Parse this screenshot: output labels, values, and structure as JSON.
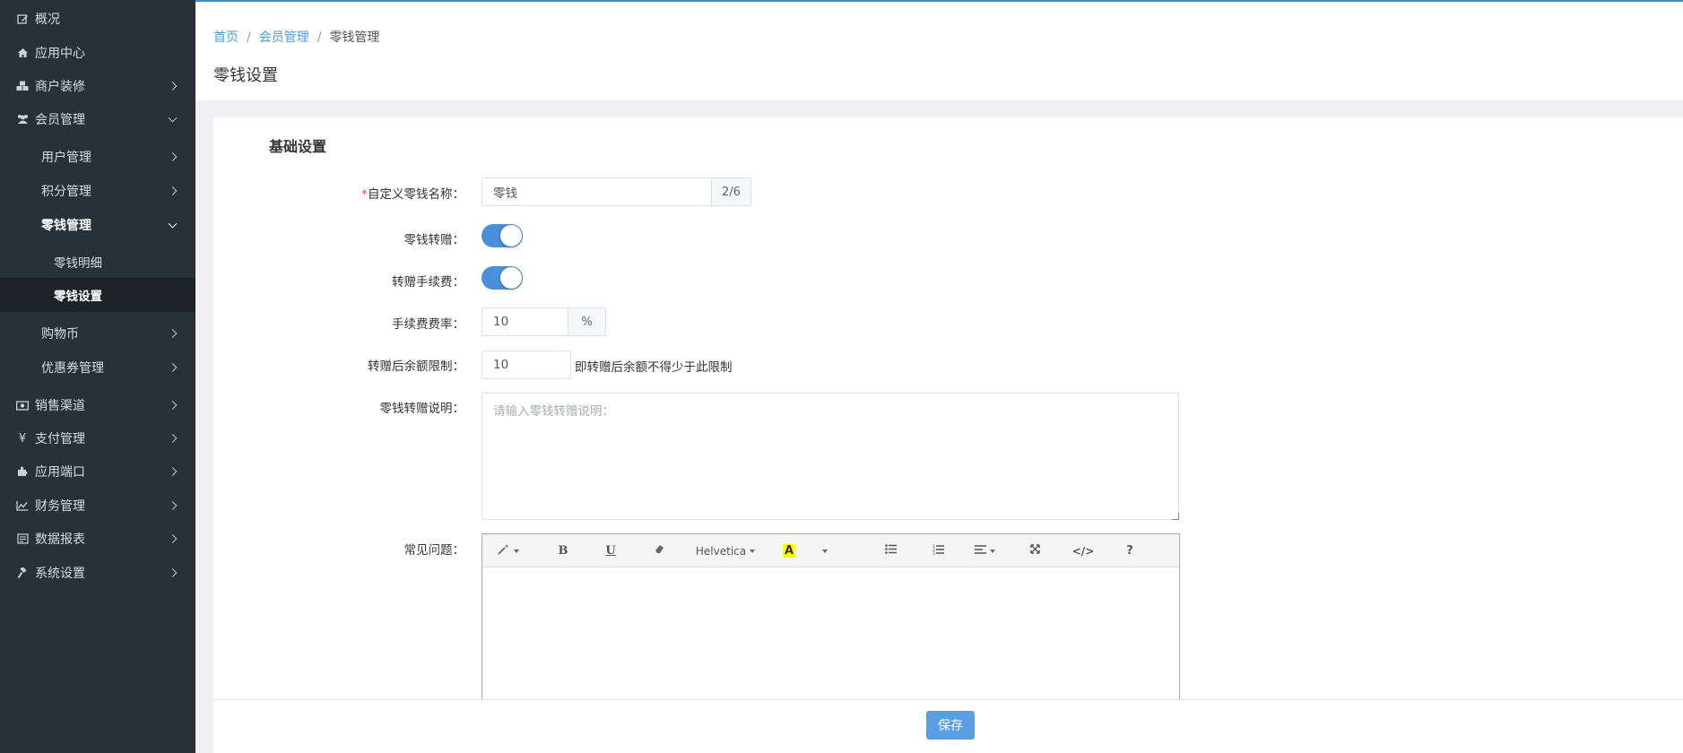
{
  "sidebar": {
    "items": [
      {
        "label": "概况",
        "icon": "edit-icon"
      },
      {
        "label": "应用中心",
        "icon": "home-icon"
      },
      {
        "label": "商户装修",
        "icon": "cubes-icon"
      },
      {
        "label": "会员管理",
        "icon": "users-icon"
      },
      {
        "label": "用户管理"
      },
      {
        "label": "积分管理"
      },
      {
        "label": "零钱管理"
      },
      {
        "label": "零钱明细"
      },
      {
        "label": "零钱设置"
      },
      {
        "label": "购物币"
      },
      {
        "label": "优惠券管理"
      },
      {
        "label": "销售渠道",
        "icon": "money-icon"
      },
      {
        "label": "支付管理",
        "icon": "yen-icon"
      },
      {
        "label": "应用端口",
        "icon": "puzzle-icon"
      },
      {
        "label": "财务管理",
        "icon": "line-chart-icon"
      },
      {
        "label": "数据报表",
        "icon": "report-icon"
      },
      {
        "label": "系统设置",
        "icon": "gavel-icon"
      }
    ]
  },
  "breadcrumb": {
    "home": "首页",
    "sep": "/",
    "members": "会员管理",
    "current": "零钱管理"
  },
  "page_title": "零钱设置",
  "section_title": "基础设置",
  "form": {
    "name_label": "自定义零钱名称：",
    "name_required": "*",
    "name_value": "零钱",
    "name_count": "2/6",
    "transfer_label": "零钱转赠：",
    "transfer_on": true,
    "fee_label": "转赠手续费：",
    "fee_on": true,
    "rate_label": "手续费费率：",
    "rate_value": "10",
    "rate_unit": "%",
    "limit_label": "转赠后余额限制：",
    "limit_value": "10",
    "limit_hint": "即转赠后余额不得少于此限制",
    "desc_label": "零钱转赠说明：",
    "desc_placeholder": "请输入零钱转赠说明：",
    "faq_label": "常见问题："
  },
  "editor": {
    "font_name": "Helvetica",
    "bold": "B",
    "underline": "U",
    "highlight": "A",
    "code": "</>",
    "help": "?"
  },
  "footer": {
    "save_label": "保存"
  },
  "colors": {
    "accent": "#4a8fdc",
    "sidebar_bg": "#263238",
    "save": "#5a9fe4"
  }
}
